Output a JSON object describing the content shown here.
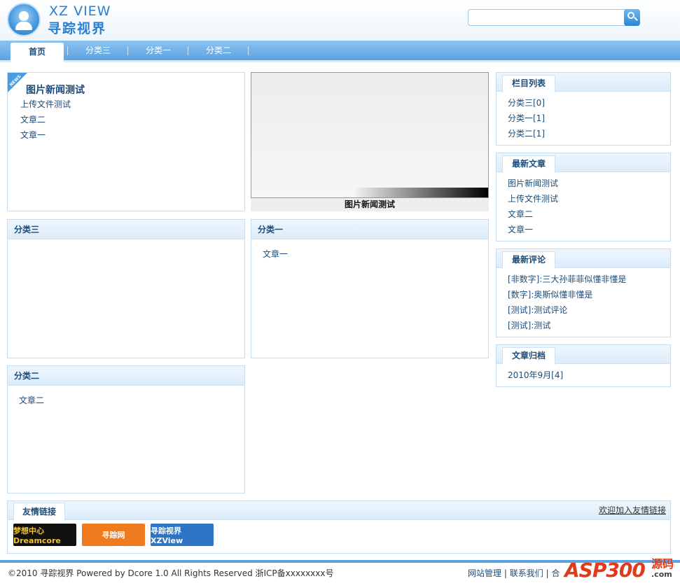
{
  "header": {
    "logo_en": "XZ VIEW",
    "logo_cn": "寻踪视界",
    "search_placeholder": ""
  },
  "nav": {
    "items": [
      {
        "label": "首页"
      },
      {
        "label": "分类三"
      },
      {
        "label": "分类一"
      },
      {
        "label": "分类二"
      }
    ]
  },
  "news": {
    "tag": "NEWS",
    "title": "图片新闻测试",
    "items": [
      "上传文件测试",
      "文章二",
      "文章一"
    ]
  },
  "picture": {
    "caption": "图片新闻测试"
  },
  "categories": [
    {
      "title": "分类三",
      "items": []
    },
    {
      "title": "分类一",
      "items": [
        "文章一"
      ]
    },
    {
      "title": "分类二",
      "items": [
        "文章二"
      ]
    }
  ],
  "sidebar": {
    "columns": {
      "title": "栏目列表",
      "items": [
        "分类三[0]",
        "分类一[1]",
        "分类二[1]"
      ]
    },
    "latest": {
      "title": "最新文章",
      "items": [
        "图片新闻测试",
        "上传文件测试",
        "文章二",
        "文章一"
      ]
    },
    "comments": {
      "title": "最新评论",
      "items": [
        "[非数字]:三大孙菲菲似懂非懂是",
        "[数字]:奥斯似懂非懂是",
        "[测试]:测试评论",
        "[测试]:测试"
      ]
    },
    "archive": {
      "title": "文章归档",
      "items": [
        "2010年9月[4]"
      ]
    }
  },
  "links": {
    "title": "友情链接",
    "join_text": "欢迎加入友情链接",
    "logos": [
      "梦想中心 Dreamcore",
      "寻踪网",
      "寻踪视界 XZView"
    ]
  },
  "footer": {
    "copyright": "©2010 寻踪视界 Powered by Dcore 1.0 All Rights Reserved 浙ICP备xxxxxxxx号",
    "admin": "网站管理",
    "contact": "联系我们",
    "sep": "|",
    "trunc": "合"
  },
  "watermark": {
    "text": "ASP300",
    "cn": "源码",
    "com": ".com"
  },
  "colors": {
    "accent": "#5aa3e2",
    "link": "#1d4c7a"
  }
}
